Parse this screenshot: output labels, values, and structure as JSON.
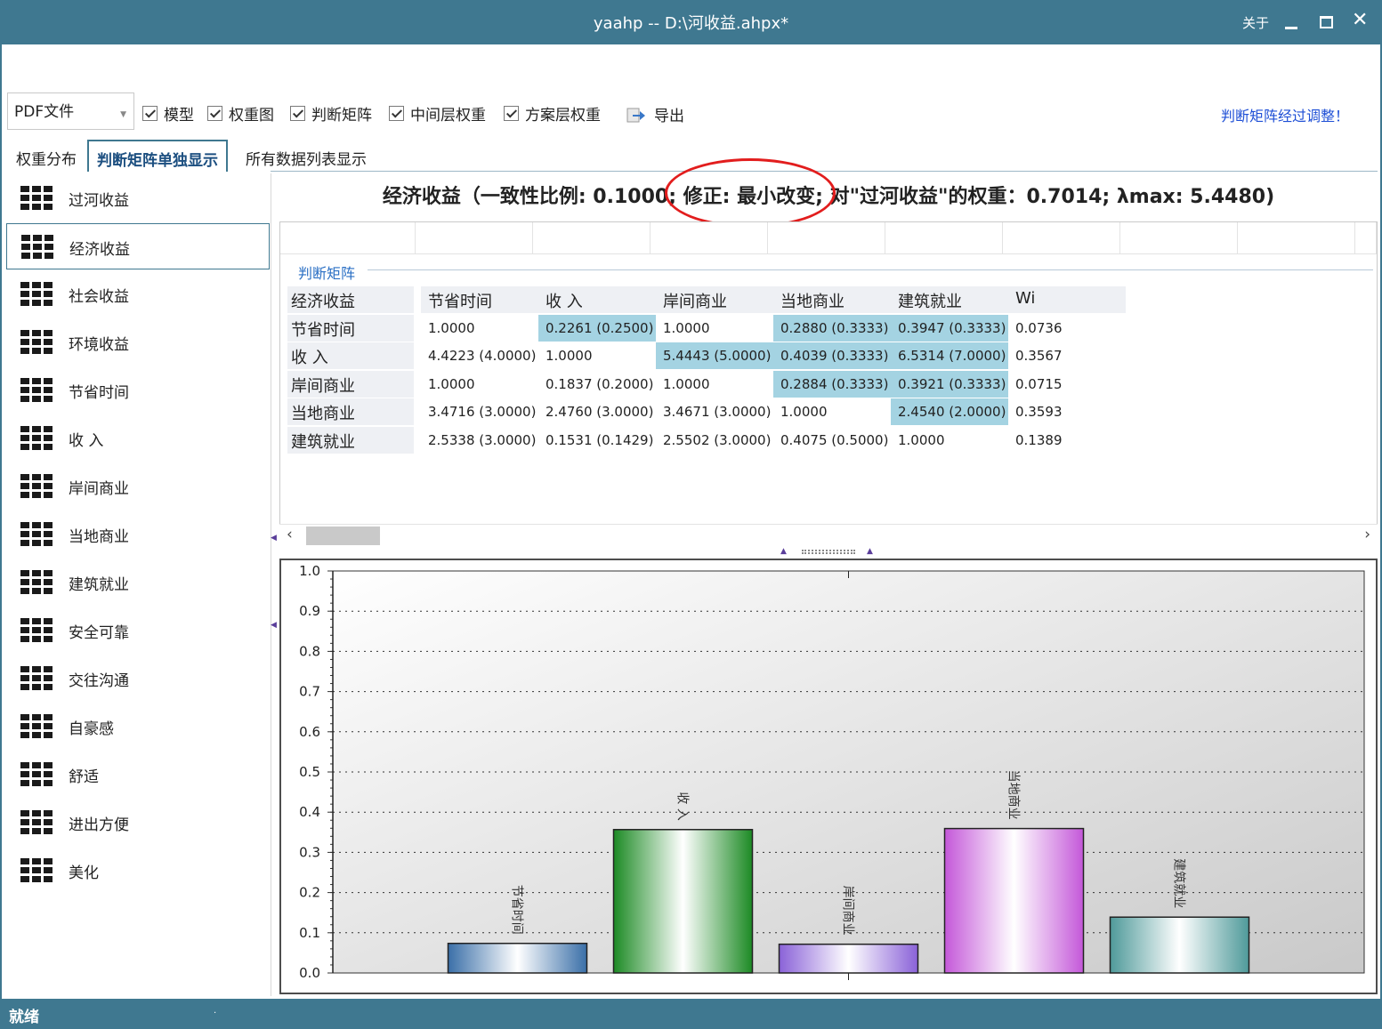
{
  "window": {
    "title": "yaahp  --  D:\\河收益.ahpx*",
    "about_label": "关于",
    "minimize_icon": "minimize-icon",
    "maximize_icon": "maximize-icon",
    "close_icon": "close-icon"
  },
  "toolbar": {
    "format_select_value": "PDF文件",
    "checkboxes": [
      {
        "label": "模型",
        "checked": true
      },
      {
        "label": "权重图",
        "checked": true
      },
      {
        "label": "判断矩阵",
        "checked": true
      },
      {
        "label": "中间层权重",
        "checked": true
      },
      {
        "label": "方案层权重",
        "checked": true
      }
    ],
    "export_label": "导出",
    "adjust_notice": "判断矩阵经过调整！"
  },
  "tabs": [
    {
      "label": "权重分布",
      "active": false
    },
    {
      "label": "判断矩阵单独显示",
      "active": true
    },
    {
      "label": "所有数据列表显示",
      "active": false
    }
  ],
  "sidebar": {
    "items": [
      {
        "label": "过河收益",
        "selected": false
      },
      {
        "label": "经济收益",
        "selected": true
      },
      {
        "label": "社会收益",
        "selected": false
      },
      {
        "label": "环境收益",
        "selected": false
      },
      {
        "label": "节省时间",
        "selected": false
      },
      {
        "label": "收  入",
        "selected": false
      },
      {
        "label": "岸间商业",
        "selected": false
      },
      {
        "label": "当地商业",
        "selected": false
      },
      {
        "label": "建筑就业",
        "selected": false
      },
      {
        "label": "安全可靠",
        "selected": false
      },
      {
        "label": "交往沟通",
        "selected": false
      },
      {
        "label": "自豪感",
        "selected": false
      },
      {
        "label": "舒适",
        "selected": false
      },
      {
        "label": "进出方便",
        "selected": false
      },
      {
        "label": "美化",
        "selected": false
      }
    ]
  },
  "matrix": {
    "heading": "经济收益（一致性比例: 0.1000; 修正: 最小改变; 对\"过河收益\"的权重：0.7014; λmax: 5.4480)",
    "group_label": "判断矩阵",
    "columns": [
      "经济收益",
      "节省时间",
      "收  入",
      "岸间商业",
      "当地商业",
      "建筑就业",
      "Wi"
    ],
    "rows": [
      {
        "name": "节省时间",
        "cells": [
          "1.0000",
          "0.2261 (0.2500)",
          "1.0000",
          "0.2880 (0.3333)",
          "0.3947 (0.3333)",
          "0.0736"
        ],
        "highlight": [
          false,
          true,
          false,
          true,
          true,
          false
        ]
      },
      {
        "name": "收  入",
        "cells": [
          "4.4223 (4.0000)",
          "1.0000",
          "5.4443 (5.0000)",
          "0.4039 (0.3333)",
          "6.5314 (7.0000)",
          "0.3567"
        ],
        "highlight": [
          false,
          false,
          true,
          true,
          true,
          false
        ]
      },
      {
        "name": "岸间商业",
        "cells": [
          "1.0000",
          "0.1837 (0.2000)",
          "1.0000",
          "0.2884 (0.3333)",
          "0.3921 (0.3333)",
          "0.0715"
        ],
        "highlight": [
          false,
          false,
          false,
          true,
          true,
          false
        ]
      },
      {
        "name": "当地商业",
        "cells": [
          "3.4716 (3.0000)",
          "2.4760 (3.0000)",
          "3.4671 (3.0000)",
          "1.0000",
          "2.4540 (2.0000)",
          "0.3593"
        ],
        "highlight": [
          false,
          false,
          false,
          false,
          true,
          false
        ]
      },
      {
        "name": "建筑就业",
        "cells": [
          "2.5338 (3.0000)",
          "0.1531 (0.1429)",
          "2.5502 (3.0000)",
          "0.4075 (0.5000)",
          "1.0000",
          "0.1389"
        ],
        "highlight": [
          false,
          false,
          false,
          false,
          false,
          false
        ]
      }
    ]
  },
  "chart_data": {
    "type": "bar",
    "categories": [
      "节省时间",
      "收  入",
      "岸间商业",
      "当地商业",
      "建筑就业"
    ],
    "values": [
      0.0736,
      0.3567,
      0.0715,
      0.3593,
      0.1389
    ],
    "ylim": [
      0,
      1.0
    ],
    "yticks": [
      "1.0",
      "0.9",
      "0.8",
      "0.7",
      "0.6",
      "0.5",
      "0.4",
      "0.3",
      "0.2",
      "0.1",
      "0.0"
    ],
    "grid": true,
    "colors": [
      "#3a6fa8",
      "#1c8a24",
      "#8a62d8",
      "#c458d9",
      "#4f9a9a"
    ],
    "legend": "none"
  },
  "status": {
    "text": "就绪"
  }
}
